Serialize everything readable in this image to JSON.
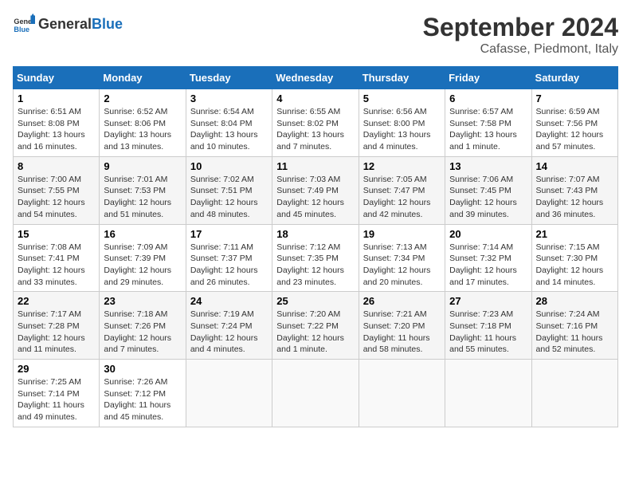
{
  "header": {
    "logo_general": "General",
    "logo_blue": "Blue",
    "month": "September 2024",
    "location": "Cafasse, Piedmont, Italy"
  },
  "days_of_week": [
    "Sunday",
    "Monday",
    "Tuesday",
    "Wednesday",
    "Thursday",
    "Friday",
    "Saturday"
  ],
  "weeks": [
    [
      {
        "day": "1",
        "detail": "Sunrise: 6:51 AM\nSunset: 8:08 PM\nDaylight: 13 hours\nand 16 minutes."
      },
      {
        "day": "2",
        "detail": "Sunrise: 6:52 AM\nSunset: 8:06 PM\nDaylight: 13 hours\nand 13 minutes."
      },
      {
        "day": "3",
        "detail": "Sunrise: 6:54 AM\nSunset: 8:04 PM\nDaylight: 13 hours\nand 10 minutes."
      },
      {
        "day": "4",
        "detail": "Sunrise: 6:55 AM\nSunset: 8:02 PM\nDaylight: 13 hours\nand 7 minutes."
      },
      {
        "day": "5",
        "detail": "Sunrise: 6:56 AM\nSunset: 8:00 PM\nDaylight: 13 hours\nand 4 minutes."
      },
      {
        "day": "6",
        "detail": "Sunrise: 6:57 AM\nSunset: 7:58 PM\nDaylight: 13 hours\nand 1 minute."
      },
      {
        "day": "7",
        "detail": "Sunrise: 6:59 AM\nSunset: 7:56 PM\nDaylight: 12 hours\nand 57 minutes."
      }
    ],
    [
      {
        "day": "8",
        "detail": "Sunrise: 7:00 AM\nSunset: 7:55 PM\nDaylight: 12 hours\nand 54 minutes."
      },
      {
        "day": "9",
        "detail": "Sunrise: 7:01 AM\nSunset: 7:53 PM\nDaylight: 12 hours\nand 51 minutes."
      },
      {
        "day": "10",
        "detail": "Sunrise: 7:02 AM\nSunset: 7:51 PM\nDaylight: 12 hours\nand 48 minutes."
      },
      {
        "day": "11",
        "detail": "Sunrise: 7:03 AM\nSunset: 7:49 PM\nDaylight: 12 hours\nand 45 minutes."
      },
      {
        "day": "12",
        "detail": "Sunrise: 7:05 AM\nSunset: 7:47 PM\nDaylight: 12 hours\nand 42 minutes."
      },
      {
        "day": "13",
        "detail": "Sunrise: 7:06 AM\nSunset: 7:45 PM\nDaylight: 12 hours\nand 39 minutes."
      },
      {
        "day": "14",
        "detail": "Sunrise: 7:07 AM\nSunset: 7:43 PM\nDaylight: 12 hours\nand 36 minutes."
      }
    ],
    [
      {
        "day": "15",
        "detail": "Sunrise: 7:08 AM\nSunset: 7:41 PM\nDaylight: 12 hours\nand 33 minutes."
      },
      {
        "day": "16",
        "detail": "Sunrise: 7:09 AM\nSunset: 7:39 PM\nDaylight: 12 hours\nand 29 minutes."
      },
      {
        "day": "17",
        "detail": "Sunrise: 7:11 AM\nSunset: 7:37 PM\nDaylight: 12 hours\nand 26 minutes."
      },
      {
        "day": "18",
        "detail": "Sunrise: 7:12 AM\nSunset: 7:35 PM\nDaylight: 12 hours\nand 23 minutes."
      },
      {
        "day": "19",
        "detail": "Sunrise: 7:13 AM\nSunset: 7:34 PM\nDaylight: 12 hours\nand 20 minutes."
      },
      {
        "day": "20",
        "detail": "Sunrise: 7:14 AM\nSunset: 7:32 PM\nDaylight: 12 hours\nand 17 minutes."
      },
      {
        "day": "21",
        "detail": "Sunrise: 7:15 AM\nSunset: 7:30 PM\nDaylight: 12 hours\nand 14 minutes."
      }
    ],
    [
      {
        "day": "22",
        "detail": "Sunrise: 7:17 AM\nSunset: 7:28 PM\nDaylight: 12 hours\nand 11 minutes."
      },
      {
        "day": "23",
        "detail": "Sunrise: 7:18 AM\nSunset: 7:26 PM\nDaylight: 12 hours\nand 7 minutes."
      },
      {
        "day": "24",
        "detail": "Sunrise: 7:19 AM\nSunset: 7:24 PM\nDaylight: 12 hours\nand 4 minutes."
      },
      {
        "day": "25",
        "detail": "Sunrise: 7:20 AM\nSunset: 7:22 PM\nDaylight: 12 hours\nand 1 minute."
      },
      {
        "day": "26",
        "detail": "Sunrise: 7:21 AM\nSunset: 7:20 PM\nDaylight: 11 hours\nand 58 minutes."
      },
      {
        "day": "27",
        "detail": "Sunrise: 7:23 AM\nSunset: 7:18 PM\nDaylight: 11 hours\nand 55 minutes."
      },
      {
        "day": "28",
        "detail": "Sunrise: 7:24 AM\nSunset: 7:16 PM\nDaylight: 11 hours\nand 52 minutes."
      }
    ],
    [
      {
        "day": "29",
        "detail": "Sunrise: 7:25 AM\nSunset: 7:14 PM\nDaylight: 11 hours\nand 49 minutes."
      },
      {
        "day": "30",
        "detail": "Sunrise: 7:26 AM\nSunset: 7:12 PM\nDaylight: 11 hours\nand 45 minutes."
      },
      {
        "day": "",
        "detail": ""
      },
      {
        "day": "",
        "detail": ""
      },
      {
        "day": "",
        "detail": ""
      },
      {
        "day": "",
        "detail": ""
      },
      {
        "day": "",
        "detail": ""
      }
    ]
  ]
}
